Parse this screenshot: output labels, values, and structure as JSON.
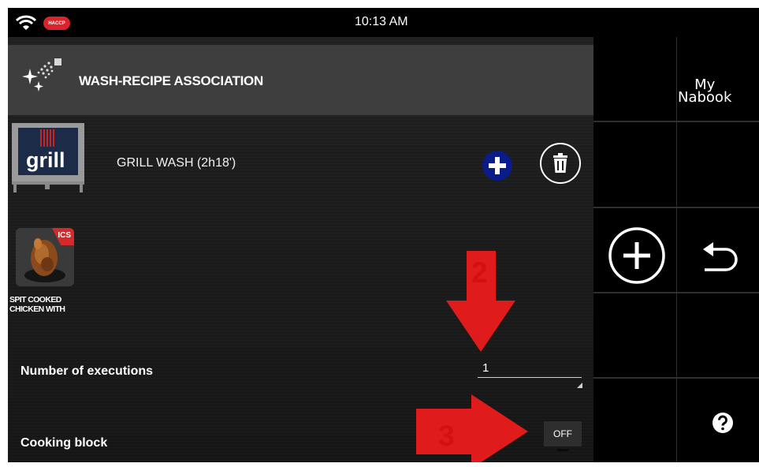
{
  "status_bar": {
    "time": "10:13 AM",
    "badge": "HACCP"
  },
  "header": {
    "title": "WASH-RECIPE ASSOCIATION",
    "icon": "wash-sparkle-icon"
  },
  "wash": {
    "label": "GRILL WASH (2h18')",
    "thumb_text": "grill",
    "add_icon": "plus-icon",
    "delete_icon": "trash-icon"
  },
  "recipe": {
    "badge": "ICS",
    "name_line1": "SPIT COOKED",
    "name_line2": "CHICKEN WITH"
  },
  "executions": {
    "label": "Number of executions",
    "value": "1"
  },
  "cooking_block": {
    "label": "Cooking block",
    "state": "OFF"
  },
  "annotations": {
    "arrow_2_label": "2",
    "arrow_3_label": "3",
    "color": "#e01b1b"
  },
  "sidebar": {
    "logo_line1": "My",
    "logo_line2": "Nabook",
    "buttons": [
      "add-circle-icon",
      "back-arrow-icon",
      "help-icon"
    ]
  },
  "colors": {
    "background": "#121212",
    "header_bar": "#3e3e3e",
    "add_button": "#0a1b8a",
    "annotation_red": "#e01b1b",
    "haccp_red": "#d8242c"
  }
}
